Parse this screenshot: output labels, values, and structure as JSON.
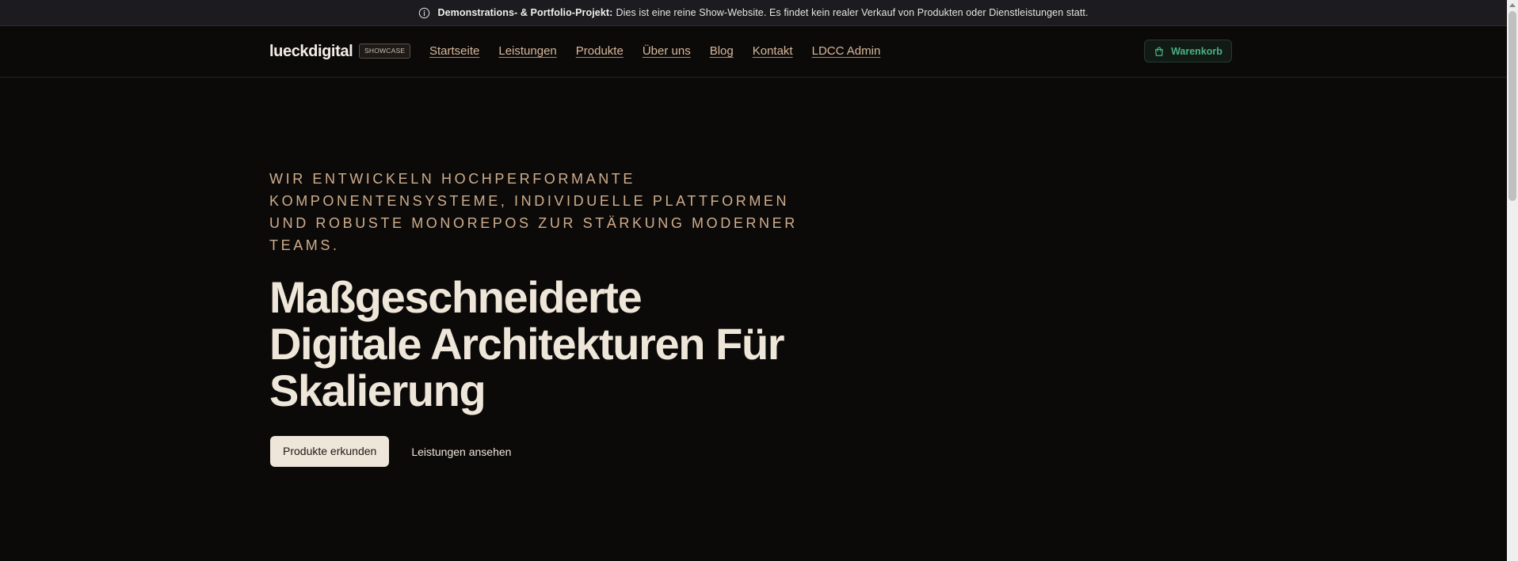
{
  "notice": {
    "icon": "info-icon",
    "label": "Demonstrations- & Portfolio-Projekt:",
    "text": "Dies ist eine reine Show-Website. Es findet kein realer Verkauf von Produkten oder Dienstleistungen statt."
  },
  "header": {
    "logo": "lueckdigital",
    "badge": "SHOWCASE",
    "nav": [
      "Startseite",
      "Leistungen",
      "Produkte",
      "Über uns",
      "Blog",
      "Kontakt",
      "LDCC Admin"
    ],
    "cart": {
      "icon": "shopping-bag-icon",
      "label": "Warenkorb"
    }
  },
  "hero": {
    "eyebrow": "Wir entwickeln hochperformante Komponentensysteme, individuelle Plattformen und robuste Monorepos zur Stärkung moderner Teams.",
    "headline_lines": [
      "Maßgeschneiderte",
      "Digitale Architekturen Für",
      "Skalierung"
    ],
    "primary_cta": "Produkte erkunden",
    "secondary_cta": "Leistungen ansehen"
  },
  "colors": {
    "background": "#0c0a09",
    "notice_bar": "#1b1b20",
    "accent_tan": "#d9b99b",
    "accent_green": "#49b281",
    "text_light": "#efe6da"
  }
}
